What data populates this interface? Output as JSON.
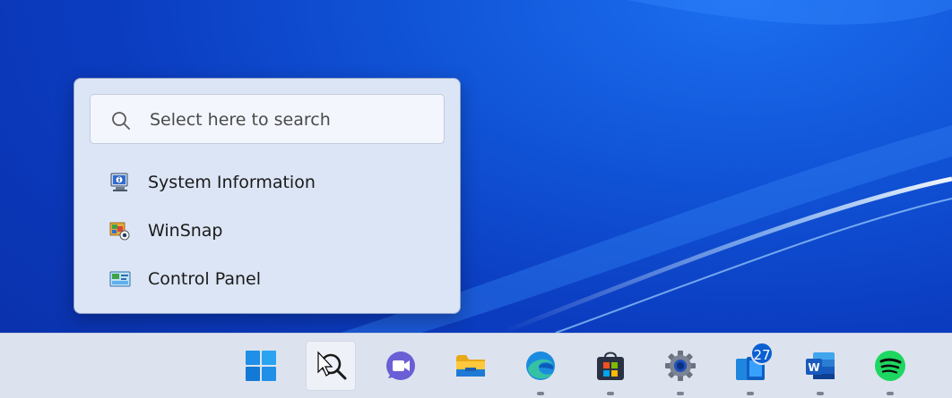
{
  "search_flyout": {
    "placeholder": "Select here to search",
    "results": [
      {
        "label": "System Information",
        "icon": "system-information-icon"
      },
      {
        "label": "WinSnap",
        "icon": "winsnap-icon"
      },
      {
        "label": "Control Panel",
        "icon": "control-panel-icon"
      }
    ]
  },
  "taskbar": {
    "apps": [
      {
        "name": "start",
        "icon": "windows-start-icon"
      },
      {
        "name": "search",
        "icon": "search-icon",
        "active": true
      },
      {
        "name": "teams-chat",
        "icon": "teams-chat-icon"
      },
      {
        "name": "file-explorer",
        "icon": "folder-icon"
      },
      {
        "name": "edge",
        "icon": "edge-icon",
        "running": true
      },
      {
        "name": "microsoft-store",
        "icon": "store-icon",
        "running": true
      },
      {
        "name": "settings",
        "icon": "gear-icon",
        "running": true
      },
      {
        "name": "phone-link",
        "icon": "phone-link-icon",
        "running": true,
        "badge": "27"
      },
      {
        "name": "word",
        "icon": "word-icon",
        "running": true
      },
      {
        "name": "spotify",
        "icon": "spotify-icon",
        "running": true
      }
    ]
  },
  "colors": {
    "wallpaper": "#0b3cc0",
    "taskbar": "#dde3ee",
    "flyout": "#dce5f5",
    "badge": "#0b5fd0"
  }
}
